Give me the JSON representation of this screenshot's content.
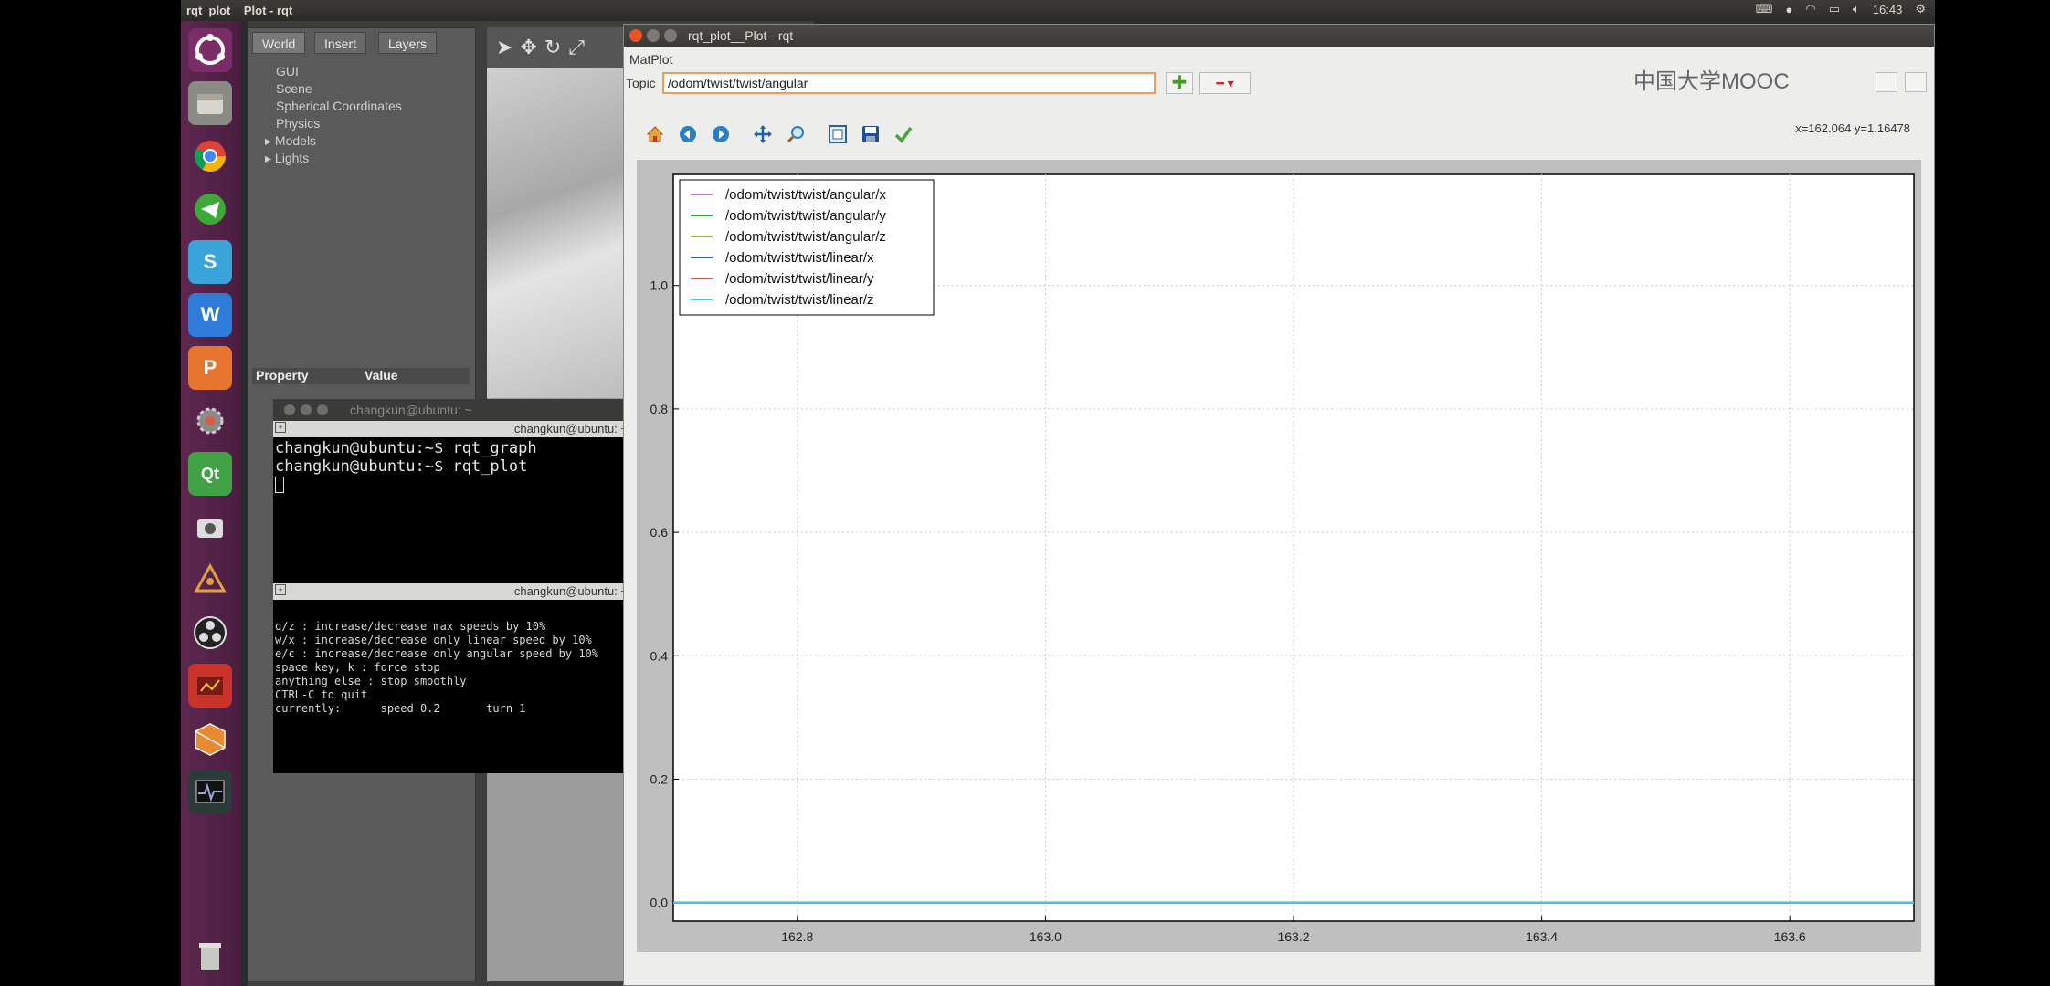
{
  "top_panel": {
    "title": "rqt_plot__Plot - rqt",
    "time": "16:43"
  },
  "gazebo": {
    "tabs": [
      "World",
      "Insert",
      "Layers"
    ],
    "tree": [
      "GUI",
      "Scene",
      "Spherical Coordinates",
      "Physics",
      "Models",
      "Lights"
    ],
    "property_header": "Property",
    "value_header": "Value"
  },
  "terminal": {
    "title": "changkun@ubuntu: ~",
    "tab1_label": "changkun@ubuntu: ~",
    "lines1": [
      "changkun@ubuntu:~$ rqt_graph",
      "changkun@ubuntu:~$ rqt_plot"
    ],
    "tab2_label": "changkun@ubuntu: ~",
    "lines2": [
      "q/z : increase/decrease max speeds by 10%",
      "w/x : increase/decrease only linear speed by 10%",
      "e/c : increase/decrease only angular speed by 10%",
      "space key, k : force stop",
      "anything else : stop smoothly",
      "",
      "CTRL-C to quit",
      "",
      "currently:      speed 0.2       turn 1"
    ]
  },
  "rqt": {
    "window_title": "rqt_plot__Plot - rqt",
    "plugin_label": "MatPlot",
    "topic_label": "Topic",
    "topic_value": "/odom/twist/twist/angular",
    "add_symbol": "✚",
    "remove_symbol": "━ ▾",
    "watermark": "中国大学MOOC",
    "coord_readout": "x=162.064    y=1.16478"
  },
  "chart_data": {
    "type": "line",
    "title": "",
    "xlabel": "",
    "ylabel": "",
    "xlim": [
      162.7,
      163.7
    ],
    "ylim": [
      -0.03,
      1.18
    ],
    "xticks": [
      162.8,
      163.0,
      163.2,
      163.4,
      163.6
    ],
    "xtick_labels": [
      "162.8",
      "163.0",
      "163.2",
      "163.4",
      "163.6"
    ],
    "yticks": [
      0.0,
      0.2,
      0.4,
      0.6,
      0.8,
      1.0
    ],
    "ytick_labels": [
      "0.0",
      "0.2",
      "0.4",
      "0.6",
      "0.8",
      "1.0"
    ],
    "grid": true,
    "legend_position": "top-left",
    "series": [
      {
        "name": "/odom/twist/twist/angular/x",
        "color": "#c879c8",
        "x": [
          162.7,
          163.7
        ],
        "y": [
          0.0,
          0.0
        ]
      },
      {
        "name": "/odom/twist/twist/angular/y",
        "color": "#3aa33a",
        "x": [
          162.7,
          163.7
        ],
        "y": [
          0.0,
          0.0
        ]
      },
      {
        "name": "/odom/twist/twist/angular/z",
        "color": "#8fb03c",
        "x": [
          162.7,
          163.7
        ],
        "y": [
          0.0,
          0.0
        ]
      },
      {
        "name": "/odom/twist/twist/linear/x",
        "color": "#3a5fa8",
        "x": [
          162.7,
          163.7
        ],
        "y": [
          0.0,
          0.0
        ]
      },
      {
        "name": "/odom/twist/twist/linear/y",
        "color": "#d9534f",
        "x": [
          162.7,
          163.7
        ],
        "y": [
          0.0,
          0.0
        ]
      },
      {
        "name": "/odom/twist/twist/linear/z",
        "color": "#4fc3e8",
        "x": [
          162.7,
          163.7
        ],
        "y": [
          0.0,
          0.0
        ]
      }
    ]
  }
}
